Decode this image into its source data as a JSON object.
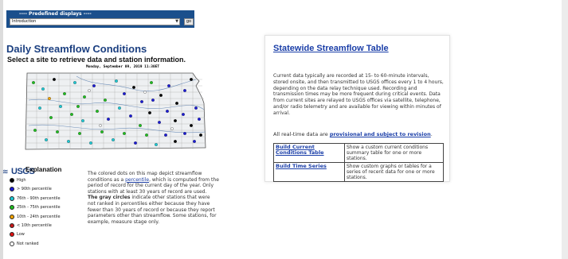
{
  "predefined": {
    "label": "---- Predefined displays ----",
    "selected": "Introduction",
    "go_label": "go"
  },
  "page": {
    "title": "Daily Streamflow Conditions",
    "subtitle": "Select a site to retrieve data and station information.",
    "map_timestamp": "Monday, September 09, 2019 11:30ET"
  },
  "usgs_logo": "USGS",
  "legend": {
    "title": "Explanation",
    "items": [
      {
        "label": "High",
        "color": "#000000"
      },
      {
        "label": "> 90th percentile",
        "color": "#1a1ad6"
      },
      {
        "label": "76th - 90th percentile",
        "color": "#1ecbd6"
      },
      {
        "label": "25th - 75th percentile",
        "color": "#1fbf1f"
      },
      {
        "label": "10th - 24th percentile",
        "color": "#f2a300"
      },
      {
        "label": "< 10th percentile",
        "color": "#c81818"
      },
      {
        "label": "Low",
        "color": "#e01010"
      },
      {
        "label": "Not ranked",
        "color": "#ffffff"
      }
    ]
  },
  "description": {
    "p1_before": "The colored dots on this map depict streamflow conditions as a ",
    "p1_link": "percentile",
    "p1_after": ", which is computed from the period of record for the current day of the year. Only stations with at least 30 years of record are used.",
    "p2_strong": "The gray circles",
    "p2_rest": " indicate other stations that were not ranked in percentiles either because they have fewer than 30 years of record or because they report parameters other than streamflow. Some stations, for example, measure stage only."
  },
  "panel": {
    "title": "Statewide Streamflow Table",
    "text": "Current data typically are recorded at 15- to 60-minute intervals, stored onsite, and then transmitted to USGS offices every 1 to 4 hours, depending on the data relay technique used. Recording and transmission times may be more frequent during critical events. Data from current sites are relayed to USGS offices via satellite, telephone, and/or radio telemetry and are available for viewing within minutes of arrival.",
    "provisional_before": "All real-time data are ",
    "provisional_link": "provisional and subject to revision",
    "provisional_after": ".",
    "options": [
      {
        "link": "Build Current Conditions Table",
        "desc": "Show a custom current conditions summary table for one or more stations."
      },
      {
        "link": "Build Time Series",
        "desc": "Show custom graphs or tables for a series of recent data for one or more stations."
      }
    ]
  }
}
